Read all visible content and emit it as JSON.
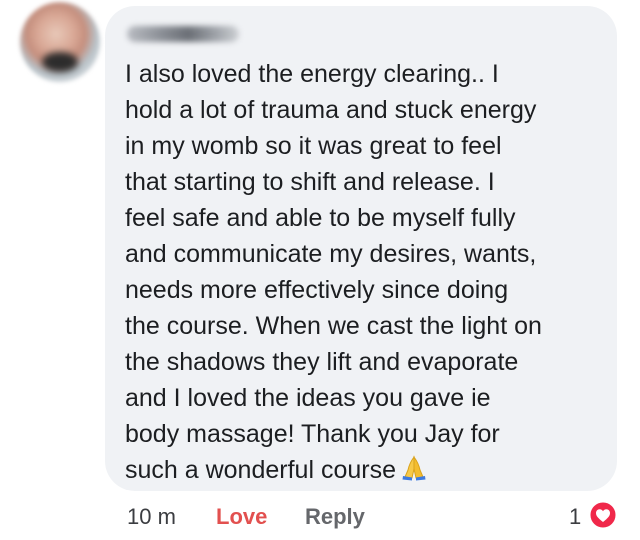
{
  "comment": {
    "author_name": "",
    "lines": [
      "I also loved the energy clearing.. I",
      "hold a lot of trauma and stuck energy",
      "in my womb so it was great to feel",
      "that starting to shift and release. I",
      "feel safe and able to be myself fully",
      "and communicate my desires, wants,",
      "needs more effectively since doing",
      "the course. When we cast the light on",
      "the shadows they lift and evaporate",
      "and I loved the ideas you gave ie",
      "body massage! Thank you Jay for",
      "such a wonderful course"
    ],
    "emoji": "folded-hands-icon"
  },
  "actions": {
    "time": "10 m",
    "love_label": "Love",
    "reply_label": "Reply",
    "reaction_count": "1",
    "reaction_icon": "heart-icon"
  },
  "colors": {
    "bubble": "#f0f2f5",
    "love": "#e2504f",
    "reply": "#65676b",
    "heart_badge": "#f0284a"
  }
}
